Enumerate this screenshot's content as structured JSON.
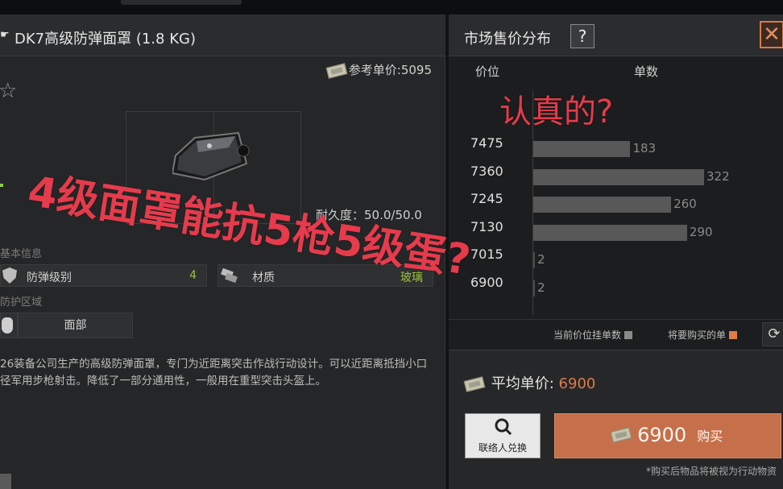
{
  "item": {
    "title": "DK7高级防弹面罩 (1.8 KG)",
    "ref_price": "参考单价:5095",
    "durability": "耐久度：50.0/50.0",
    "basic_info_heading": "基本信息",
    "stats": [
      {
        "label": "防弹级别",
        "value": "4"
      },
      {
        "label": "材质",
        "value": "玻璃"
      }
    ],
    "protect_heading": "防护区域",
    "protect_zone": "面部",
    "description": "26装备公司生产的高级防弹面罩，专门为近距离突击作战行动设计。可以近距离抵挡小口径军用步枪射击。降低了一部分通用性，一般用在重型突击头盔上。"
  },
  "market": {
    "title": "市场售价分布",
    "help": "?",
    "close": "✕",
    "col_price": "价位",
    "col_orders": "单数",
    "legend_current": "当前价位挂单数",
    "legend_buying": "将要购买的单",
    "legend_current_color": "#8a8a8a",
    "legend_buying_color": "#e07a48",
    "avg_label": "平均单价:",
    "avg_value": "6900",
    "contact_label": "联络人兑换",
    "buy_price": "6900",
    "buy_label": "购买",
    "note": "*购买后物品将被视为行动物资"
  },
  "chart_data": {
    "type": "bar",
    "orientation": "horizontal",
    "categories": [
      "7475",
      "7360",
      "7245",
      "7130",
      "7015",
      "6900"
    ],
    "values": [
      183,
      322,
      260,
      290,
      2,
      2
    ],
    "xlabel": "单数",
    "ylabel": "价位"
  },
  "overlay": {
    "caption_main": "4级面罩能抗5枪5级蛋?",
    "caption_side": "认真的?"
  }
}
